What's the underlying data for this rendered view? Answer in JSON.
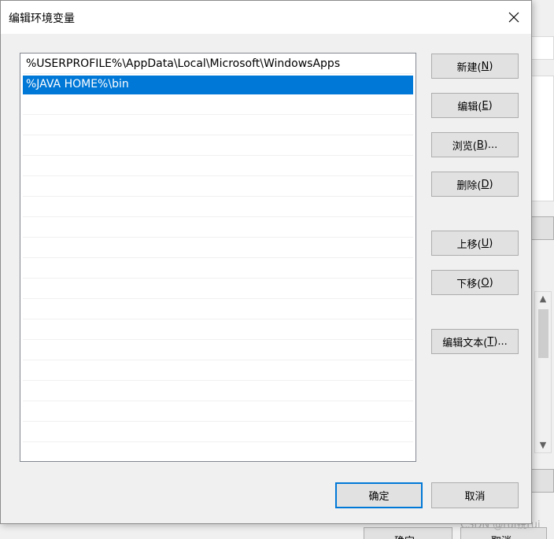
{
  "dialog": {
    "title": "编辑环境变量",
    "paths": [
      "%USERPROFILE%\\AppData\\Local\\Microsoft\\WindowsApps",
      "%JAVA HOME%\\bin"
    ],
    "selected_index": 1,
    "buttons": {
      "new": {
        "label": "新建(",
        "key": "N",
        "tail": ")"
      },
      "edit": {
        "label": "编辑(",
        "key": "E",
        "tail": ")"
      },
      "browse": {
        "label": "浏览(",
        "key": "B",
        "tail": ")..."
      },
      "delete": {
        "label": "删除(",
        "key": "D",
        "tail": ")"
      },
      "move_up": {
        "label": "上移(",
        "key": "U",
        "tail": ")"
      },
      "move_down": {
        "label": "下移(",
        "key": "O",
        "tail": ")"
      },
      "edit_text": {
        "label": "编辑文本(",
        "key": "T",
        "tail": ")..."
      }
    },
    "ok_label": "确定",
    "cancel_label": "取消"
  },
  "background": {
    "ok_label": "确定",
    "cancel_label": "取消",
    "watermark": "CSDN @rui锐rui"
  },
  "colors": {
    "selection": "#0078d7",
    "button_face": "#e1e1e1",
    "button_border": "#adadad"
  },
  "icons": [
    "close-icon",
    "scroll-up-icon",
    "scroll-down-icon"
  ]
}
